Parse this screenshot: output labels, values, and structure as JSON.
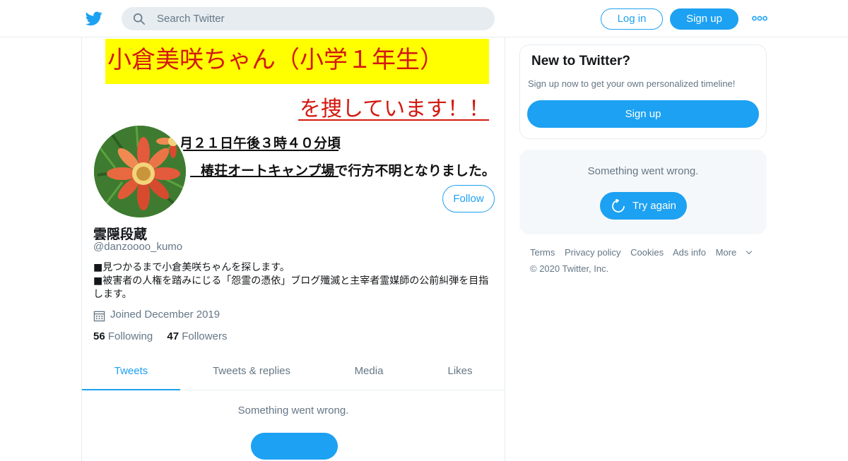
{
  "header": {
    "search_placeholder": "Search Twitter",
    "login_label": "Log in",
    "signup_label": "Sign up"
  },
  "banner": {
    "line1": "小倉美咲ちゃん（小学１年生）",
    "line2": "を捜しています！！",
    "line3": "月２１日午後３時４０分頃",
    "line4": "椿荘オートキャンプ場で行方不明となりました。"
  },
  "profile": {
    "name": "雲隠段蔵",
    "handle": "@danzoooo_kumo",
    "bio_line1": "■見つかるまで小倉美咲ちゃんを探します。",
    "bio_line2": "■被害者の人権を踏みにじる「怨霊の憑依」ブログ殲滅と主宰者霊媒師の公前糾弾を目指します。",
    "joined": "Joined December 2019",
    "following_count": "56",
    "following_label": "Following",
    "followers_count": "47",
    "followers_label": "Followers",
    "follow_label": "Follow"
  },
  "tabs": [
    {
      "label": "Tweets",
      "active": true
    },
    {
      "label": "Tweets & replies",
      "active": false
    },
    {
      "label": "Media",
      "active": false
    },
    {
      "label": "Likes",
      "active": false
    }
  ],
  "timeline": {
    "error": "Something went wrong."
  },
  "sidebar": {
    "new_title": "New to Twitter?",
    "new_sub": "Sign up now to get your own personalized timeline!",
    "signup_label": "Sign up",
    "error_msg": "Something went wrong.",
    "try_again": "Try again"
  },
  "footer": {
    "links": [
      "Terms",
      "Privacy policy",
      "Cookies",
      "Ads info",
      "More"
    ],
    "copyright": "© 2020 Twitter, Inc."
  },
  "colors": {
    "accent": "#1da1f2",
    "muted": "#657786",
    "banner_yellow": "#ffff00",
    "banner_red": "#d3190f"
  }
}
